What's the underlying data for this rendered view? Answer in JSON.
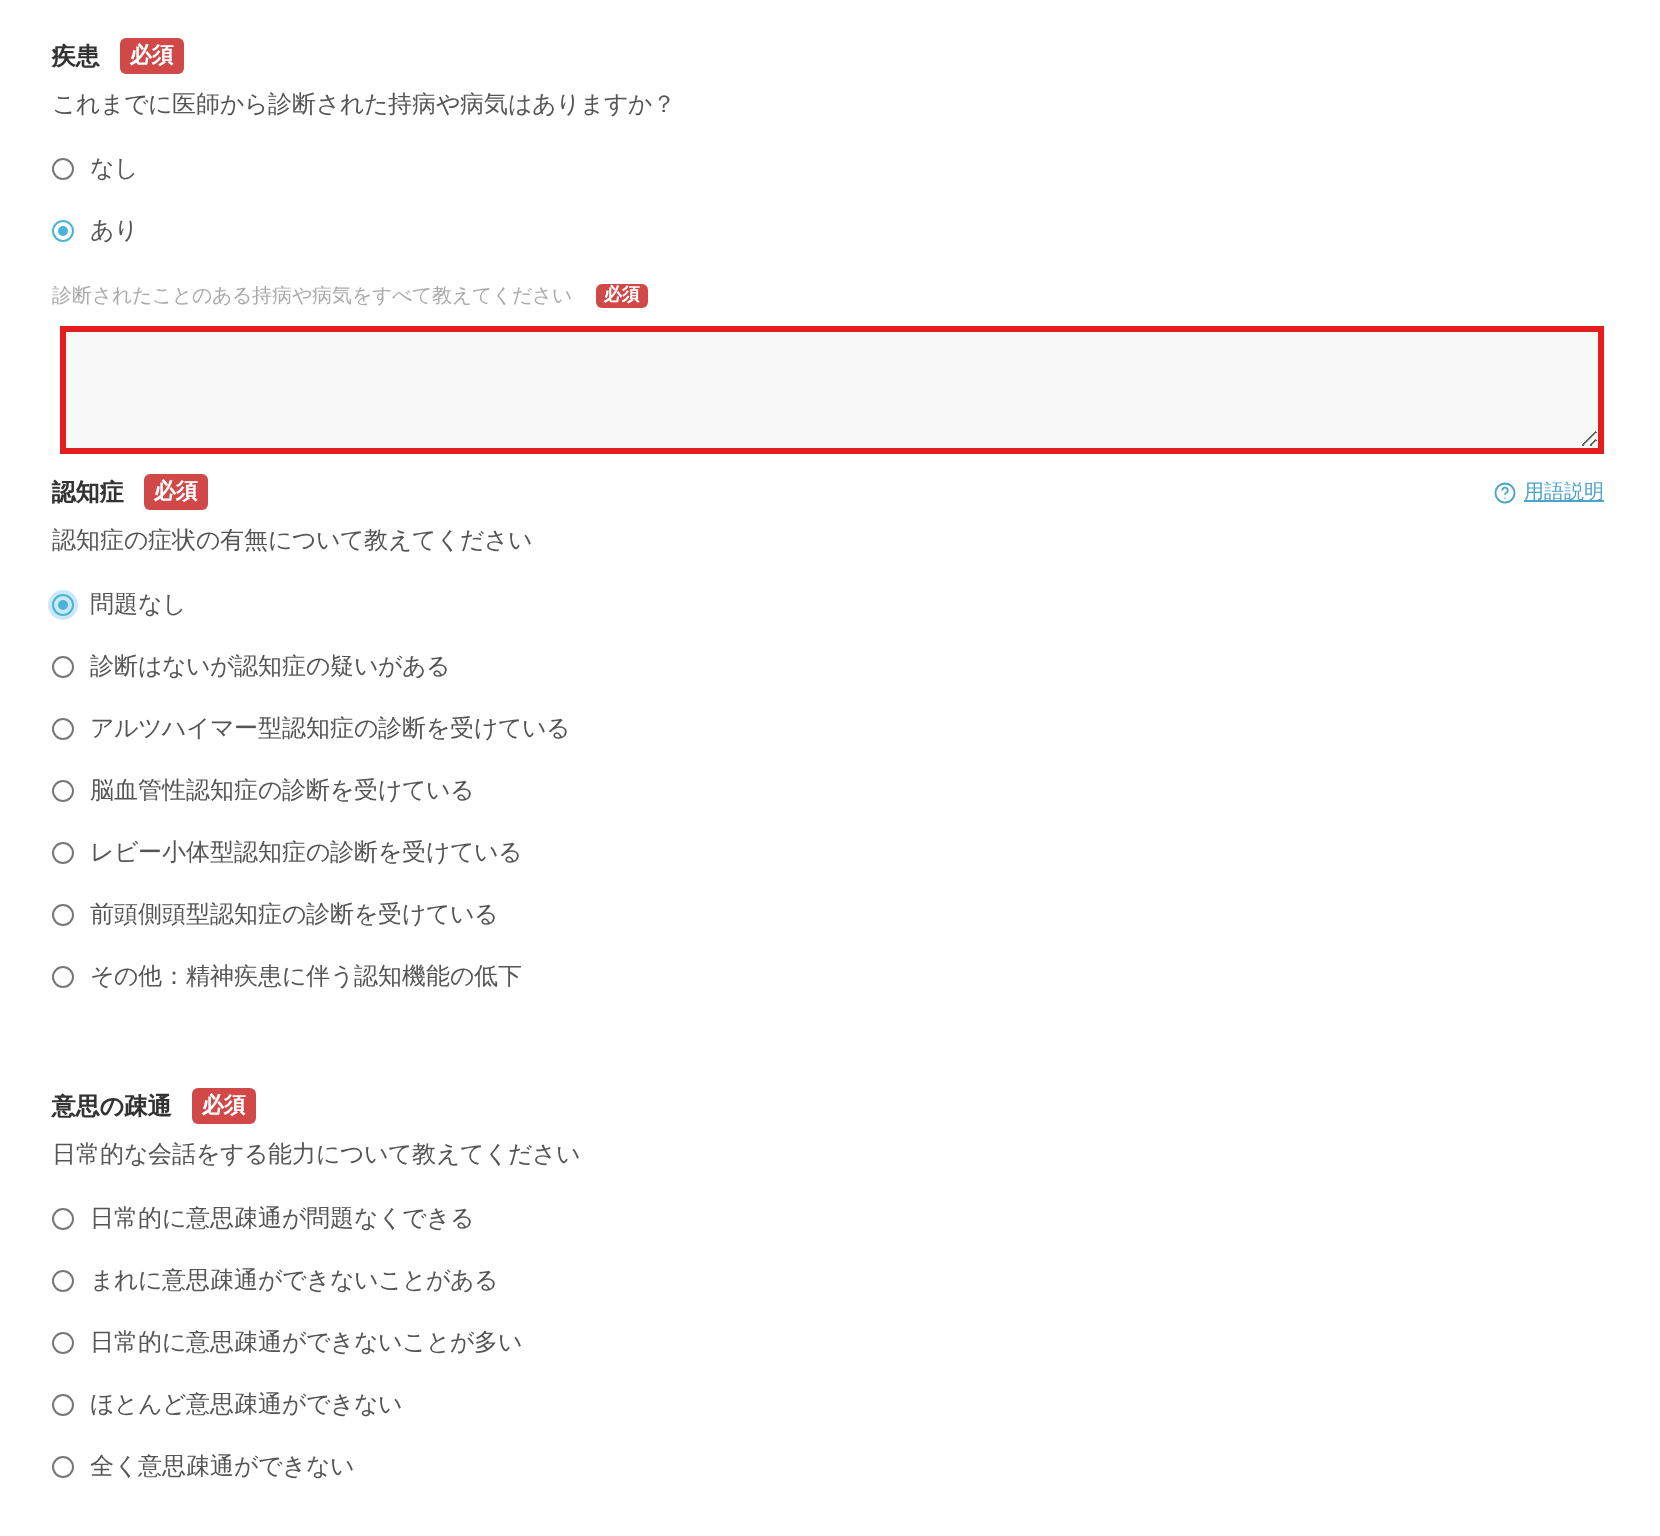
{
  "sections": [
    {
      "title": "疾患",
      "badge": "必須",
      "question": "これまでに医師から診断された持病や病気はありますか？",
      "options": [
        {
          "label": "なし",
          "selected": false,
          "focused": false
        },
        {
          "label": "あり",
          "selected": true,
          "focused": false
        }
      ],
      "sub_field": {
        "label": "診断されたことのある持病や病気をすべて教えてください",
        "badge": "必須",
        "invalid": true
      }
    },
    {
      "title": "認知症",
      "badge": "必須",
      "help_link": "用語説明",
      "question": "認知症の症状の有無について教えてください",
      "options": [
        {
          "label": "問題なし",
          "selected": true,
          "focused": true
        },
        {
          "label": "診断はないが認知症の疑いがある",
          "selected": false,
          "focused": false
        },
        {
          "label": "アルツハイマー型認知症の診断を受けている",
          "selected": false,
          "focused": false
        },
        {
          "label": "脳血管性認知症の診断を受けている",
          "selected": false,
          "focused": false
        },
        {
          "label": "レビー小体型認知症の診断を受けている",
          "selected": false,
          "focused": false
        },
        {
          "label": "前頭側頭型認知症の診断を受けている",
          "selected": false,
          "focused": false
        },
        {
          "label": "その他：精神疾患に伴う認知機能の低下",
          "selected": false,
          "focused": false
        }
      ]
    },
    {
      "title": "意思の疎通",
      "badge": "必須",
      "question": "日常的な会話をする能力について教えてください",
      "options": [
        {
          "label": "日常的に意思疎通が問題なくできる",
          "selected": false,
          "focused": false
        },
        {
          "label": "まれに意思疎通ができないことがある",
          "selected": false,
          "focused": false
        },
        {
          "label": "日常的に意思疎通ができないことが多い",
          "selected": false,
          "focused": false
        },
        {
          "label": "ほとんど意思疎通ができない",
          "selected": false,
          "focused": false
        },
        {
          "label": "全く意思疎通ができない",
          "selected": false,
          "focused": false
        }
      ]
    }
  ]
}
